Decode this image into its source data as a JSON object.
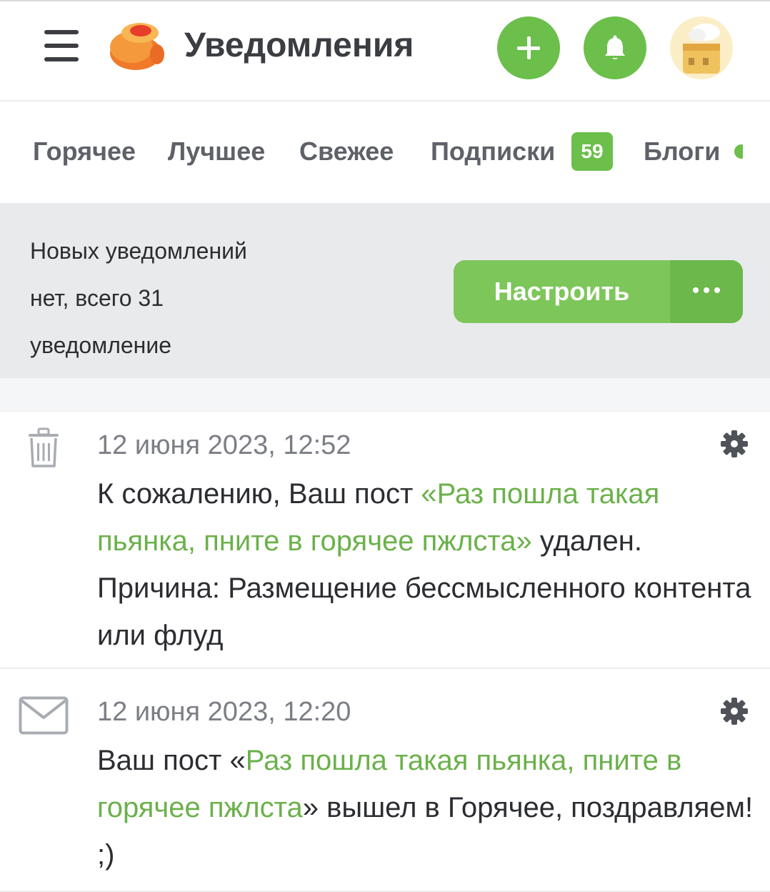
{
  "header": {
    "title": "Уведомления",
    "menu_icon": "hamburger-menu-icon",
    "logo_icon": "pikabu-logo-icon",
    "add_icon": "plus-icon",
    "notifications_icon": "bell-icon",
    "avatar_icon": "user-avatar"
  },
  "tabs": [
    {
      "label": "Горячее"
    },
    {
      "label": "Лучшее"
    },
    {
      "label": "Свежее"
    },
    {
      "label": "Подписки",
      "badge": "59"
    },
    {
      "label": "Блоги"
    }
  ],
  "info": {
    "line1": "Новых уведомлений",
    "line2": "нет, всего 31",
    "line3": "уведомление",
    "configure_label": "Настроить",
    "more_label": "···"
  },
  "notifications": [
    {
      "icon": "trash-icon",
      "date": "12 июня 2023, 12:52",
      "text_before": "К сожалению, Ваш пост ",
      "link_text": "«Раз пошла такая пьянка, пните в горячее пжлста»",
      "text_after": " удален. Причина: Размещение бессмысленного контента или флуд"
    },
    {
      "icon": "envelope-icon",
      "date": "12 июня 2023, 12:20",
      "text_before": "Ваш пост «",
      "link_text": "Раз пошла такая пьянка, пните в горячее пжлста",
      "text_after": "» вышел в Горячее, поздравляем! ;)"
    }
  ],
  "colors": {
    "accent_green": "#6bbf4a",
    "link_green": "#6bb14a",
    "panel_gray": "#e9eaec"
  }
}
